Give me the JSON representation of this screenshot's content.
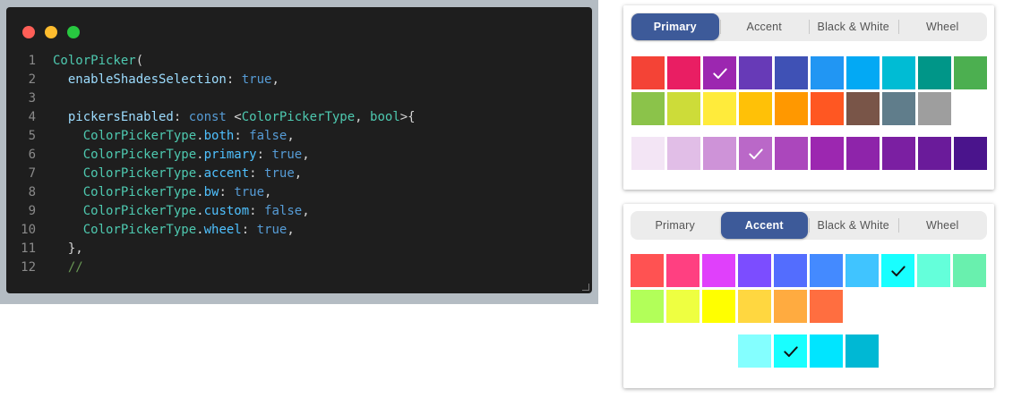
{
  "editor": {
    "window_dots": [
      "#ff5f57",
      "#febc2e",
      "#28c840"
    ],
    "lines": [
      {
        "num": "1",
        "tokens": [
          {
            "t": "ColorPicker",
            "c": "class"
          },
          {
            "t": "(",
            "c": "punct"
          }
        ]
      },
      {
        "num": "2",
        "tokens": [
          {
            "t": "  enableShadesSelection",
            "c": "param"
          },
          {
            "t": ": ",
            "c": "punct"
          },
          {
            "t": "true",
            "c": "kw"
          },
          {
            "t": ",",
            "c": "punct"
          }
        ]
      },
      {
        "num": "3",
        "tokens": []
      },
      {
        "num": "4",
        "tokens": [
          {
            "t": "  pickersEnabled",
            "c": "param"
          },
          {
            "t": ": ",
            "c": "punct"
          },
          {
            "t": "const ",
            "c": "kw"
          },
          {
            "t": "<",
            "c": "punct"
          },
          {
            "t": "ColorPickerType",
            "c": "class"
          },
          {
            "t": ", ",
            "c": "punct"
          },
          {
            "t": "bool",
            "c": "class"
          },
          {
            "t": ">{",
            "c": "punct"
          }
        ]
      },
      {
        "num": "5",
        "tokens": [
          {
            "t": "    ColorPickerType",
            "c": "class"
          },
          {
            "t": ".",
            "c": "punct"
          },
          {
            "t": "both",
            "c": "prop"
          },
          {
            "t": ": ",
            "c": "punct"
          },
          {
            "t": "false",
            "c": "kw"
          },
          {
            "t": ",",
            "c": "punct"
          }
        ]
      },
      {
        "num": "6",
        "tokens": [
          {
            "t": "    ColorPickerType",
            "c": "class"
          },
          {
            "t": ".",
            "c": "punct"
          },
          {
            "t": "primary",
            "c": "prop"
          },
          {
            "t": ": ",
            "c": "punct"
          },
          {
            "t": "true",
            "c": "kw"
          },
          {
            "t": ",",
            "c": "punct"
          }
        ]
      },
      {
        "num": "7",
        "tokens": [
          {
            "t": "    ColorPickerType",
            "c": "class"
          },
          {
            "t": ".",
            "c": "punct"
          },
          {
            "t": "accent",
            "c": "prop"
          },
          {
            "t": ": ",
            "c": "punct"
          },
          {
            "t": "true",
            "c": "kw"
          },
          {
            "t": ",",
            "c": "punct"
          }
        ]
      },
      {
        "num": "8",
        "tokens": [
          {
            "t": "    ColorPickerType",
            "c": "class"
          },
          {
            "t": ".",
            "c": "punct"
          },
          {
            "t": "bw",
            "c": "prop"
          },
          {
            "t": ": ",
            "c": "punct"
          },
          {
            "t": "true",
            "c": "kw"
          },
          {
            "t": ",",
            "c": "punct"
          }
        ]
      },
      {
        "num": "9",
        "tokens": [
          {
            "t": "    ColorPickerType",
            "c": "class"
          },
          {
            "t": ".",
            "c": "punct"
          },
          {
            "t": "custom",
            "c": "prop"
          },
          {
            "t": ": ",
            "c": "punct"
          },
          {
            "t": "false",
            "c": "kw"
          },
          {
            "t": ",",
            "c": "punct"
          }
        ]
      },
      {
        "num": "10",
        "tokens": [
          {
            "t": "    ColorPickerType",
            "c": "class"
          },
          {
            "t": ".",
            "c": "punct"
          },
          {
            "t": "wheel",
            "c": "prop"
          },
          {
            "t": ": ",
            "c": "punct"
          },
          {
            "t": "true",
            "c": "kw"
          },
          {
            "t": ",",
            "c": "punct"
          }
        ]
      },
      {
        "num": "11",
        "tokens": [
          {
            "t": "  },",
            "c": "punct"
          }
        ]
      },
      {
        "num": "12",
        "tokens": [
          {
            "t": "  //",
            "c": "comment"
          }
        ]
      }
    ]
  },
  "pickers": [
    {
      "tabs": [
        {
          "label": "Primary",
          "active": true
        },
        {
          "label": "Accent",
          "active": false
        },
        {
          "label": "Black & White",
          "active": false
        },
        {
          "label": "Wheel",
          "active": false
        }
      ],
      "main_colors": [
        "#f44336",
        "#e91e63",
        "#9c27b0",
        "#673ab7",
        "#3f51b5",
        "#2196f3",
        "#03a9f4",
        "#00bcd4",
        "#009688",
        "#4caf50",
        "#8bc34a",
        "#cddc39",
        "#ffeb3b",
        "#ffc107",
        "#ff9800",
        "#ff5722",
        "#795548",
        "#607d8b",
        "#9e9e9e"
      ],
      "main_selected_index": 2,
      "shades": [
        "#f3e5f5",
        "#e1bee7",
        "#ce93d8",
        "#ba68c8",
        "#ab47bc",
        "#9c27b0",
        "#8e24aa",
        "#7b1fa2",
        "#6a1b9a",
        "#4a148c"
      ],
      "shade_selected_index": 3
    },
    {
      "tabs": [
        {
          "label": "Primary",
          "active": false
        },
        {
          "label": "Accent",
          "active": true
        },
        {
          "label": "Black & White",
          "active": false
        },
        {
          "label": "Wheel",
          "active": false
        }
      ],
      "main_colors": [
        "#ff5252",
        "#ff4081",
        "#e040fb",
        "#7c4dff",
        "#536dfe",
        "#448aff",
        "#40c4ff",
        "#18ffff",
        "#64ffda",
        "#69f0ae",
        "#b2ff59",
        "#eeff41",
        "#ffff00",
        "#ffd740",
        "#ffab40",
        "#ff6e40"
      ],
      "main_selected_index": 7,
      "shades": [
        "#84ffff",
        "#18ffff",
        "#00e5ff",
        "#00b8d4"
      ],
      "shade_selected_index": 1
    }
  ]
}
